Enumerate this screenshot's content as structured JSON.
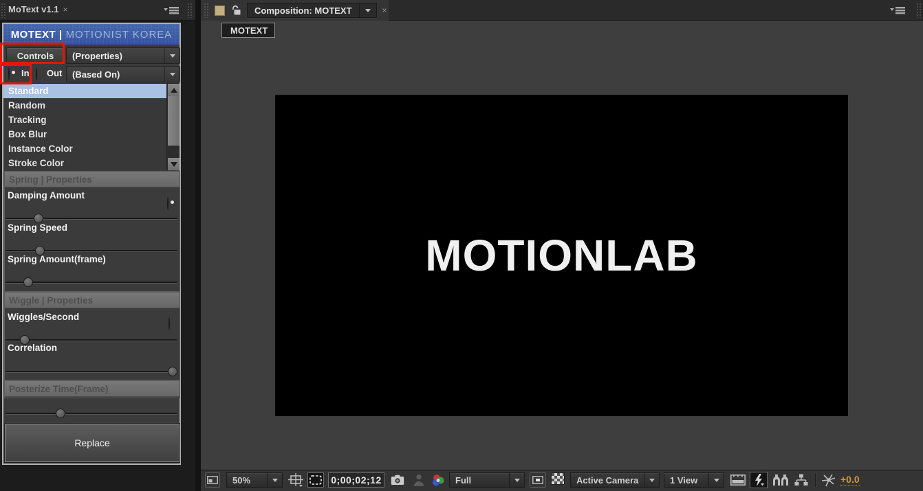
{
  "left_panel": {
    "tab_title": "MoText v1.1",
    "tab_close": "×",
    "brand_bold": "MOTEXT |",
    "brand_light": "MOTIONIST KOREA",
    "controls_button": "Controls",
    "properties_dropdown": "(Properties)",
    "in_label": "In",
    "out_label": "Out",
    "based_on_dropdown": "(Based On)",
    "preset_list": {
      "items": [
        "Standard",
        "Random",
        "Tracking",
        "Box Blur",
        "Instance Color",
        "Stroke Color"
      ],
      "selected": "Standard"
    },
    "spring": {
      "title": "Spring | Properties",
      "sliders": [
        {
          "label": "Damping Amount",
          "pct": 19,
          "has_radio": true,
          "radio_selected": true
        },
        {
          "label": "Spring Speed",
          "pct": 20
        },
        {
          "label": "Spring Amount(frame)",
          "pct": 13
        }
      ]
    },
    "wiggle": {
      "title": "Wiggle | Properties",
      "sliders": [
        {
          "label": "Wiggles/Second",
          "pct": 11,
          "has_radio": true,
          "radio_selected": false
        },
        {
          "label": "Correlation",
          "pct": 97
        }
      ]
    },
    "posterize": {
      "title": "Posterize Time(Frame)",
      "pct": 32
    },
    "replace_button": "Replace"
  },
  "comp_panel": {
    "tab_title": "Composition: MOTEXT",
    "tab_close": "×",
    "viewer_tab": "MOTEXT",
    "canvas_text": "MOTIONLAB"
  },
  "toolbar": {
    "zoom": "50%",
    "timecode": "0;00;02;12",
    "resolution": "Full",
    "camera_view": "Active Camera",
    "view_layout": "1 View",
    "exposure": "+0.0"
  },
  "icons": {
    "panel_menu": "menu-triangle-with-lines",
    "lock": "open-padlock",
    "snapshot": "camera",
    "show_snapshot": "person",
    "show_channel": "rgb-circles",
    "transparency_grid": "checkerboard",
    "fast_previews": "lightning-bolt",
    "reset_exposure": "shutter-fan"
  },
  "colors": {
    "brand_blue": "#3b5ca4",
    "annotation_red": "#e81505",
    "selection_blue": "#a9c1e2",
    "exposure_orange": "#cf9a3c",
    "canvas_bg": "#000000",
    "canvas_text": "#f0f0f0"
  }
}
